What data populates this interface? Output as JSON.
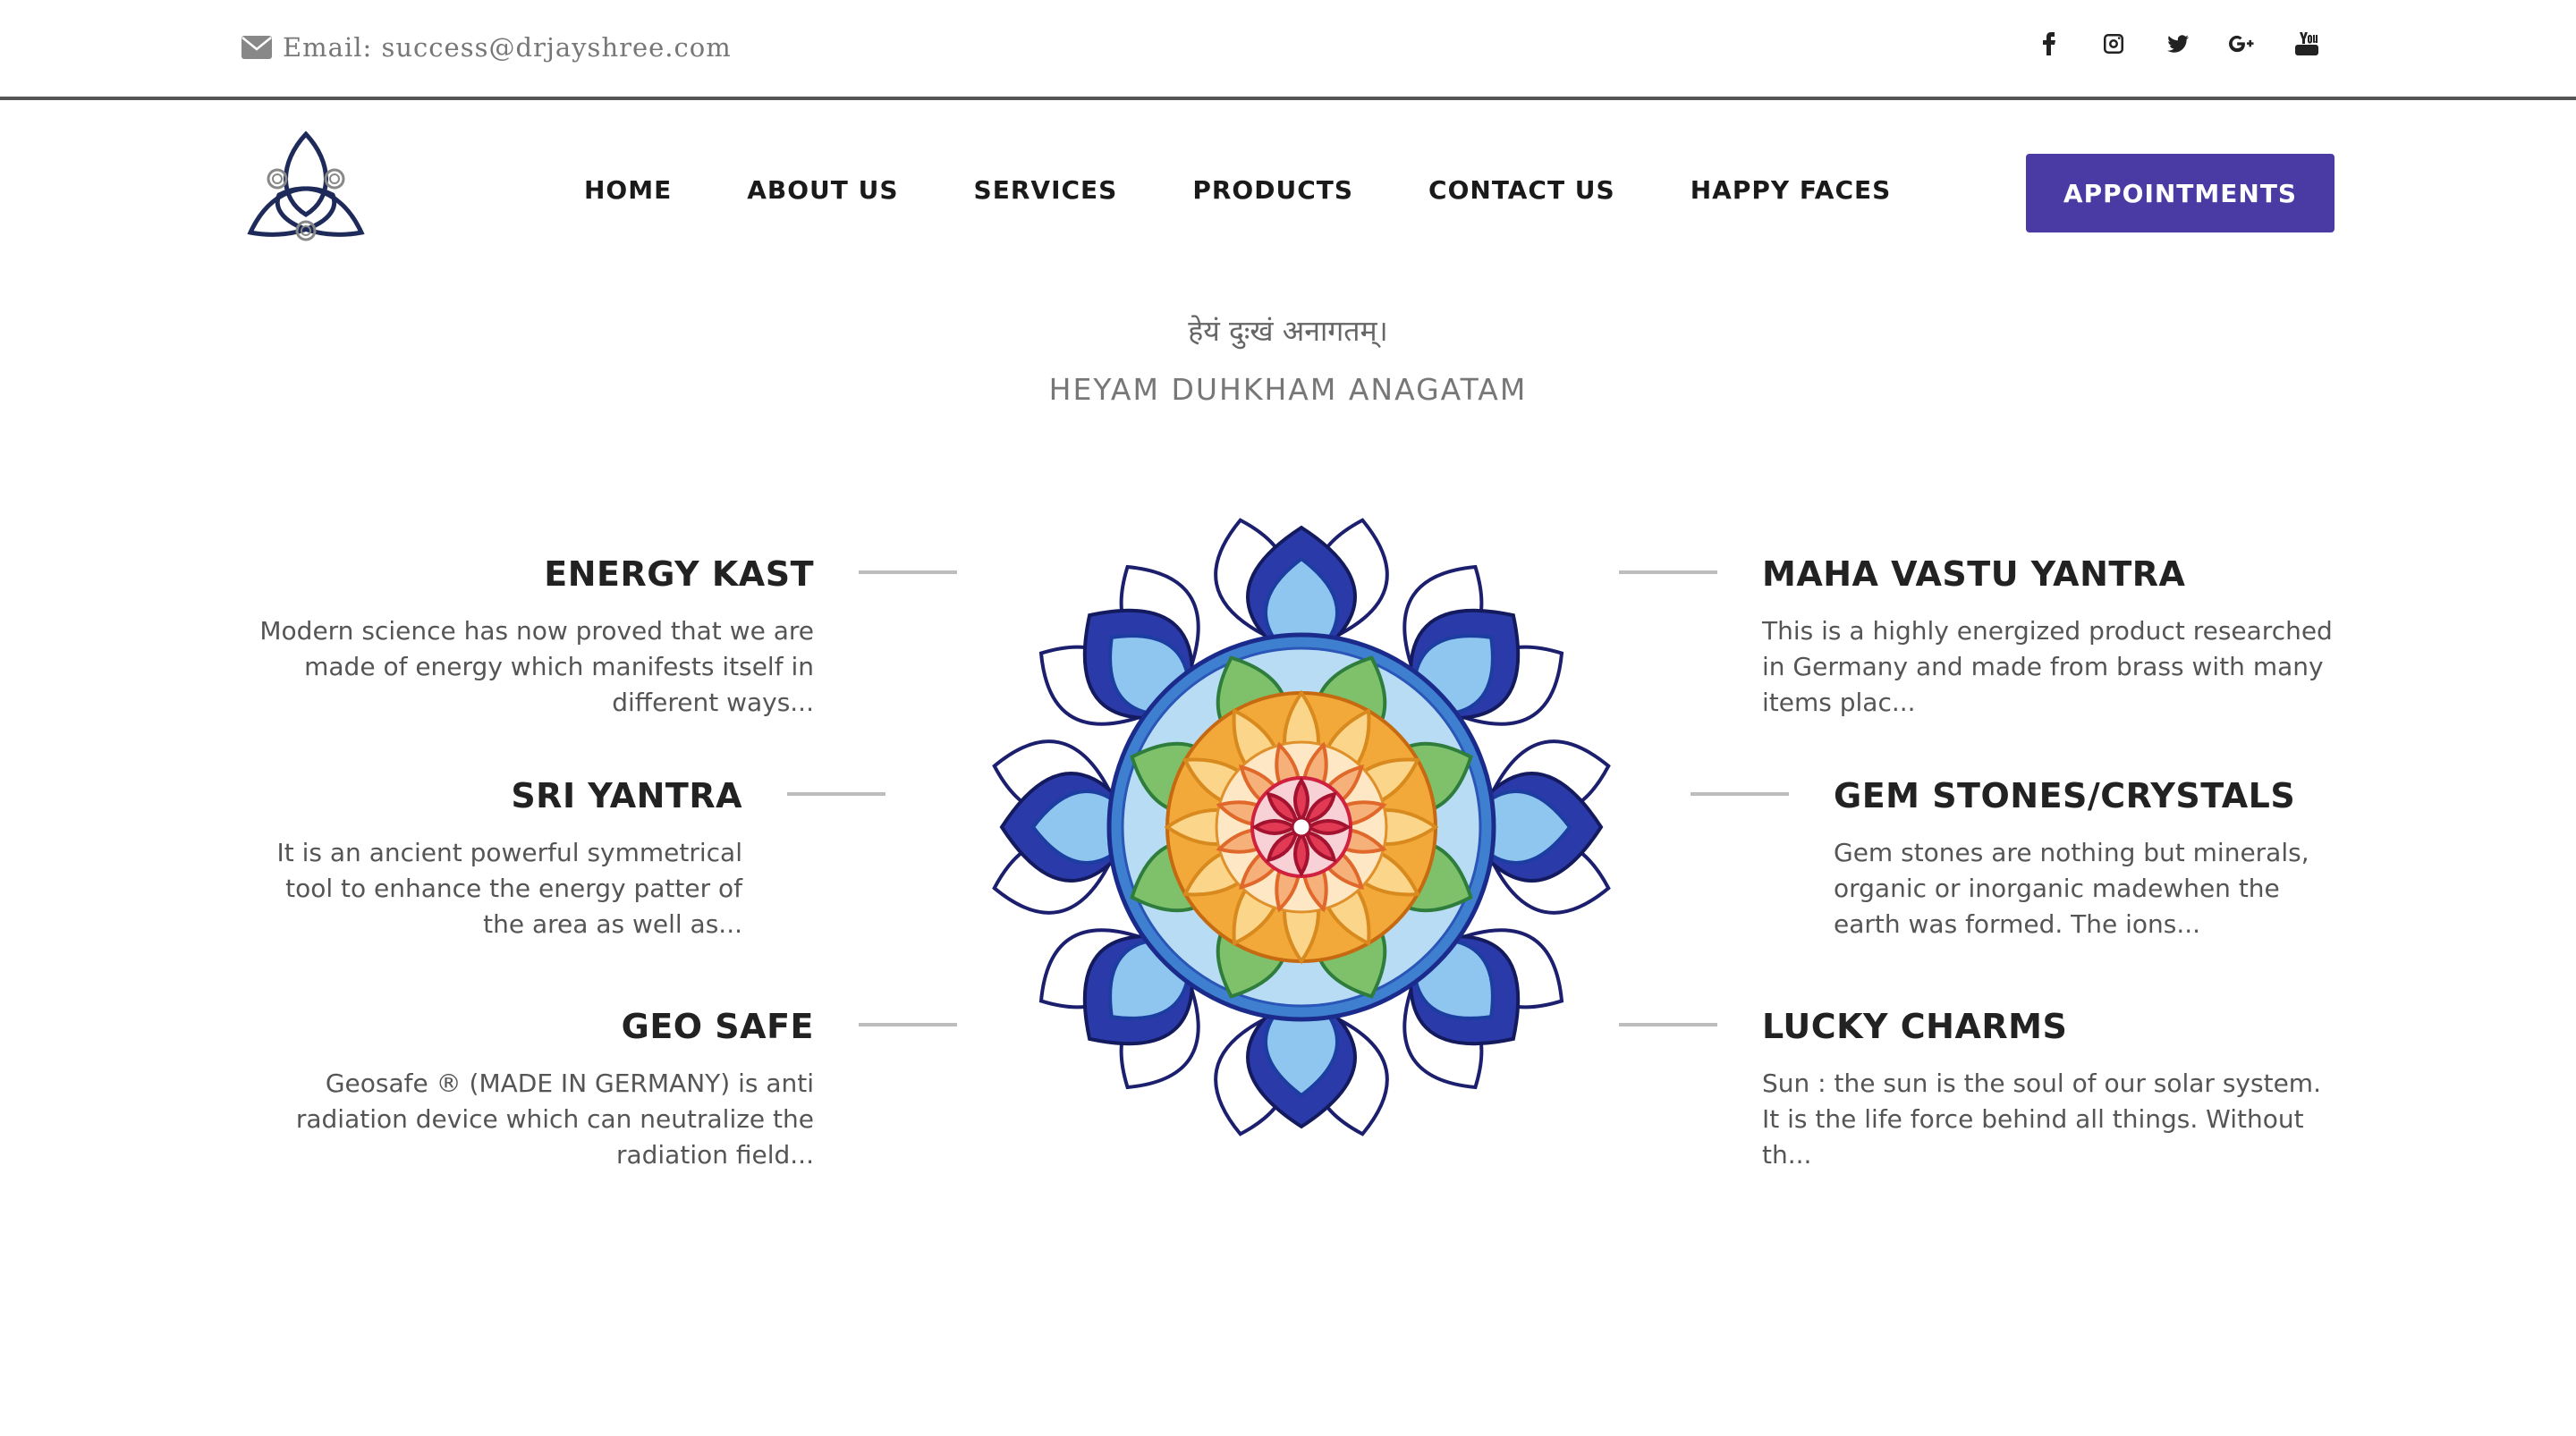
{
  "topbar": {
    "email_text": "Email: success@drjayshree.com",
    "email_icon": "envelope-icon",
    "social": [
      {
        "name": "facebook-icon"
      },
      {
        "name": "instagram-icon"
      },
      {
        "name": "twitter-icon"
      },
      {
        "name": "google-plus-icon"
      },
      {
        "name": "youtube-icon"
      }
    ]
  },
  "nav": {
    "logo": "triquetra-logo",
    "items": [
      "HOME",
      "ABOUT US",
      "SERVICES",
      "PRODUCTS",
      "CONTACT US",
      "HAPPY FACES"
    ],
    "cta": "APPOINTMENTS",
    "cta_color": "#4a3aa3"
  },
  "hero": {
    "sanskrit": "हेयं दुःखं अनागतम्।",
    "translit": "HEYAM DUHKHAM ANAGATAM"
  },
  "features": {
    "left": [
      {
        "title": "ENERGY KAST",
        "text": "Modern science has now proved that we are made of energy which manifests itself in different ways..."
      },
      {
        "title": "SRI YANTRA",
        "text": "It is an ancient powerful symmetrical tool to enhance the energy patter of the area as well as..."
      },
      {
        "title": "GEO SAFE",
        "text": "Geosafe ® (MADE IN GERMANY) is anti radiation device which can neutralize the radiation field..."
      }
    ],
    "right": [
      {
        "title": "MAHA VASTU YANTRA",
        "text": "This is a highly energized product researched in Germany and made from brass with many items plac..."
      },
      {
        "title": "GEM STONES/CRYSTALS",
        "text": "Gem stones are nothing but minerals, organic or inorganic madewhen the earth was formed. The ions..."
      },
      {
        "title": "LUCKY CHARMS",
        "text": "Sun : the sun is the soul of our solar system. It is the life force behind all things. Without th..."
      }
    ]
  },
  "mandala": {
    "name": "mandala-image"
  }
}
